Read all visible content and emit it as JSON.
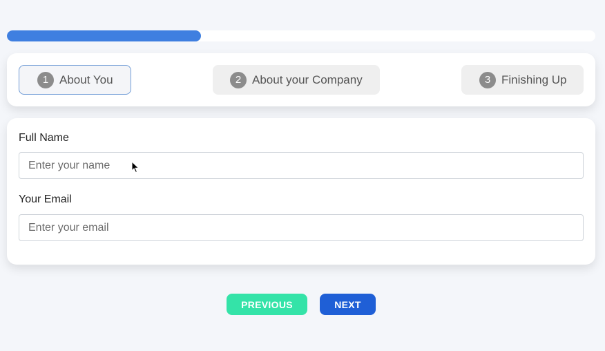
{
  "progress": {
    "fraction": 0.33,
    "color": "#3f7fe0"
  },
  "steps": [
    {
      "number": "1",
      "label": "About You",
      "active": true
    },
    {
      "number": "2",
      "label": "About your Company",
      "active": false
    },
    {
      "number": "3",
      "label": "Finishing Up",
      "active": false
    }
  ],
  "form": {
    "name_label": "Full Name",
    "name_placeholder": "Enter your name",
    "name_value": "",
    "email_label": "Your Email",
    "email_placeholder": "Enter your email",
    "email_value": ""
  },
  "buttons": {
    "previous_label": "PREVIOUS",
    "next_label": "NEXT",
    "previous_color": "#34e3a8",
    "next_color": "#1f5fd6"
  },
  "icons": {
    "cursor": "mouse-pointer-icon"
  }
}
